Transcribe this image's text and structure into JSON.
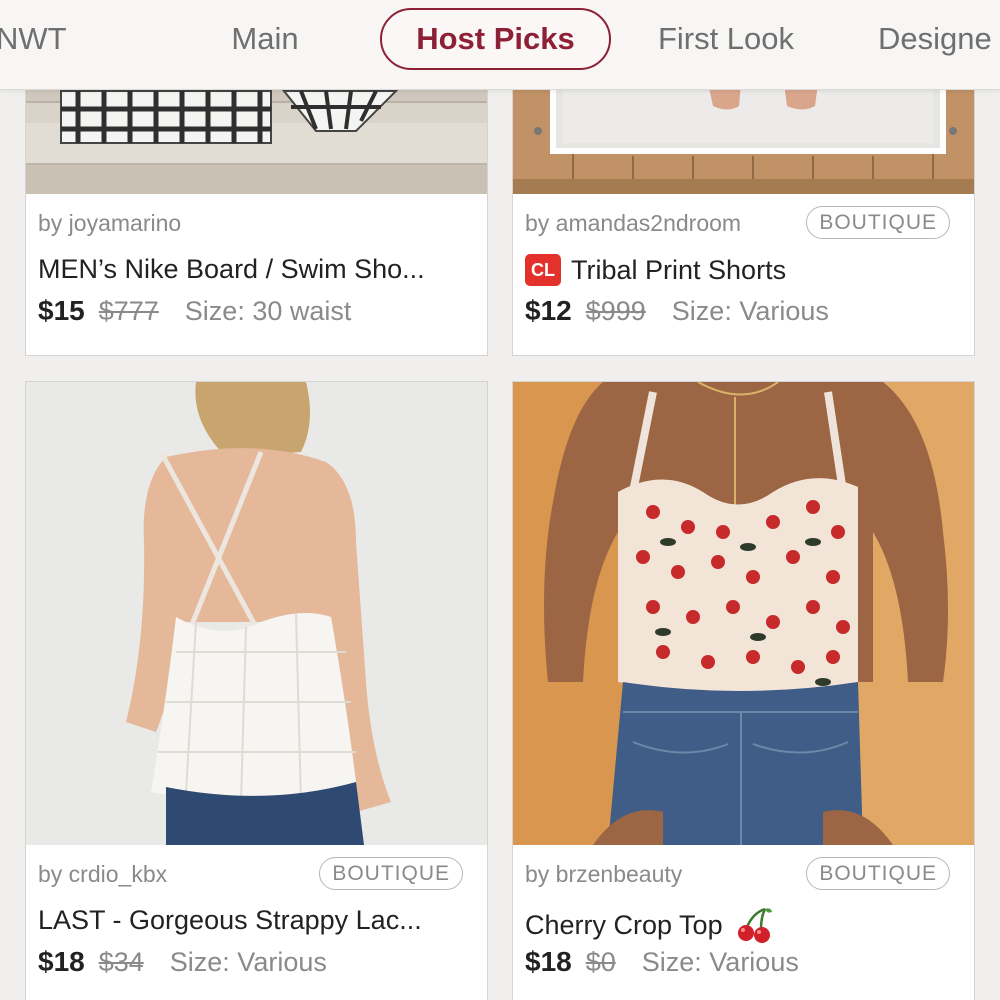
{
  "tabs": [
    {
      "label": "NWT",
      "active": false
    },
    {
      "label": "Main",
      "active": false
    },
    {
      "label": "Host Picks",
      "active": true
    },
    {
      "label": "First Look",
      "active": false
    },
    {
      "label": "Designe",
      "active": false
    }
  ],
  "listings": [
    {
      "seller": "by joyamarino",
      "badge": "",
      "title": "MEN’s Nike Board / Swim Sho...",
      "price": "$15",
      "original_price": "$777",
      "size": "Size: 30 waist"
    },
    {
      "seller": "by amandas2ndroom",
      "badge": "BOUTIQUE",
      "title_prefix_badge": "CL",
      "title": "Tribal Print Shorts",
      "price": "$12",
      "original_price": "$999",
      "size": "Size: Various"
    },
    {
      "seller": "by crdio_kbx",
      "badge": "BOUTIQUE",
      "title": "LAST - Gorgeous Strappy Lac...",
      "price": "$18",
      "original_price": "$34",
      "size": "Size: Various"
    },
    {
      "seller": "by brzenbeauty",
      "badge": "BOUTIQUE",
      "title": "Cherry Crop Top",
      "title_icon": "cherry-emoji-icon",
      "price": "$18",
      "original_price": "$0",
      "size": "Size: Various"
    }
  ],
  "colors": {
    "accent": "#8d2035",
    "cl_badge": "#e3322c"
  }
}
